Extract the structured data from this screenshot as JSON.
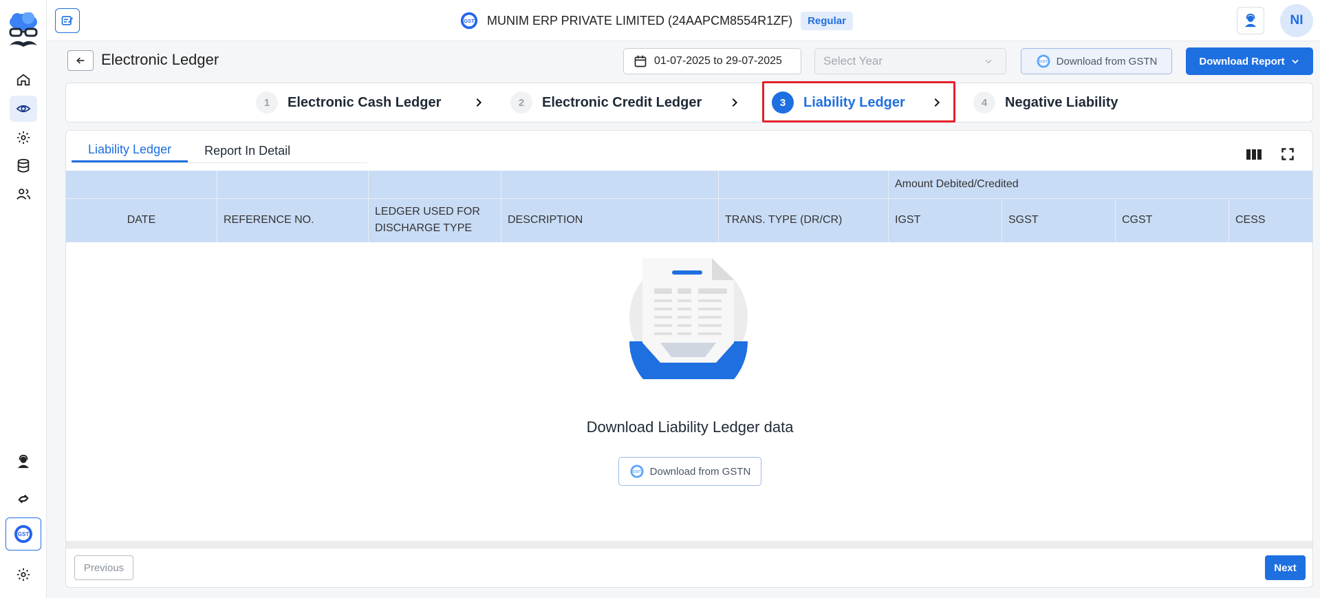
{
  "colors": {
    "accent": "#1e6fe0",
    "highlight": "#e4202a",
    "table_header": "#c9dcf6"
  },
  "sidebar": {
    "items": [
      {
        "icon": "home-icon"
      },
      {
        "icon": "eye-icon",
        "active": true
      },
      {
        "icon": "gear-icon"
      },
      {
        "icon": "database-icon"
      },
      {
        "icon": "users-icon"
      }
    ],
    "bottom": [
      {
        "icon": "support-agent-icon"
      },
      {
        "icon": "sync-icon"
      },
      {
        "icon": "gst-icon",
        "active": true
      },
      {
        "icon": "settings-icon"
      }
    ]
  },
  "topbar": {
    "company_name": "MUNIM ERP PRIVATE LIMITED (24AAPCM8554R1ZF)",
    "badge": "Regular",
    "avatar_initials": "NI"
  },
  "header": {
    "title": "Electronic Ledger",
    "date_range": "01-07-2025 to 29-07-2025",
    "year_placeholder": "Select Year",
    "download_gstn_label": "Download from GSTN",
    "download_report_label": "Download Report"
  },
  "stepper": {
    "steps": [
      {
        "num": "1",
        "label": "Electronic Cash Ledger"
      },
      {
        "num": "2",
        "label": "Electronic Credit Ledger"
      },
      {
        "num": "3",
        "label": "Liability Ledger",
        "active": true
      },
      {
        "num": "4",
        "label": "Negative Liability"
      }
    ]
  },
  "tabs": [
    "Liability Ledger",
    "Report In Detail"
  ],
  "table": {
    "group_header": "Amount Debited/Credited",
    "columns": [
      "DATE",
      "REFERENCE NO.",
      "LEDGER USED FOR DISCHARGE TYPE",
      "DESCRIPTION",
      "TRANS. TYPE (DR/CR)",
      "IGST",
      "SGST",
      "CGST",
      "CESS"
    ],
    "rows": []
  },
  "empty_state": {
    "message": "Download Liability Ledger data",
    "button_label": "Download from GSTN"
  },
  "pagination": {
    "previous": "Previous",
    "next": "Next"
  }
}
